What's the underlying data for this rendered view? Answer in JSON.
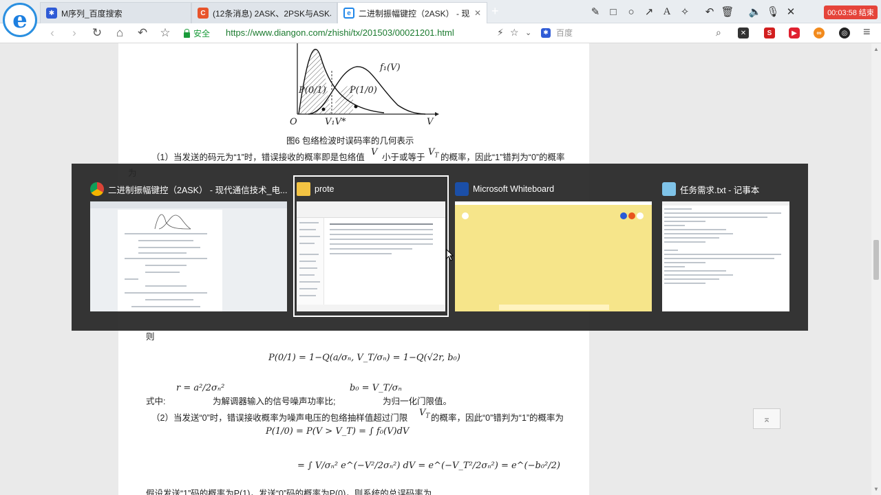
{
  "tabs": [
    {
      "label": "M序列_百度搜索",
      "active": false
    },
    {
      "label": "(12条消息) 2ASK、2PSK与ASK、P",
      "active": false
    },
    {
      "label": "二进制振幅键控（2ASK） - 现代",
      "active": true
    }
  ],
  "new_tab_label": "+",
  "timer": {
    "text": "00:03:58 结束"
  },
  "address": {
    "secure_label": "安全",
    "url": "https://www.diangon.com/zhishi/tx/201503/00021201.html",
    "search_placeholder": "百度"
  },
  "article": {
    "fig_f1": "f₁(V)",
    "fig_p01": "P(0/1)",
    "fig_p10": "P(1/0)",
    "fig_o": "O",
    "fig_vt": "V₁V*",
    "fig_v": "V",
    "figure_caption": "图6 包络检波时误码率的几何表示",
    "para1_a": "（1）当发送的码元为“1”时，错误接收的概率即是包络值",
    "para1_b": "小于或等于",
    "para1_c": "的概率，因此“1”错判为“0”的概率",
    "para1_d": "为",
    "then": "则",
    "formula_p01": "P(0/1) = 1−Q(a/σₙ, V_T/σₙ) = 1−Q(√2r, b₀)",
    "where_label": "式中:",
    "r_def": "r = a²/2σₙ²",
    "r_desc": "为解调器输入的信号噪声功率比;",
    "b0_def": "b₀ = V_T/σₙ",
    "b0_desc": "为归一化门限值。",
    "para2_a": "（2）当发送“0”时，错误接收概率为噪声电压的包络抽样值超过门限",
    "para2_b": "的概率，因此“0”错判为“1”的概率为",
    "formula_p10": "P(1/0) = P(V > V_T) = ∫ f₀(V)dV",
    "formula_int": "= ∫ V/σₙ² e^(−V²/2σₙ²) dV = e^(−V_T²/2σₙ²) = e^(−b₀²/2)",
    "para3": "假设发送“1”码的概率为P(1)，发送“0”码的概率为P(0)，则系统的总误码率为"
  },
  "switcher": {
    "windows": [
      {
        "title": "二进制振幅键控（2ASK） - 现代通信技术_电...",
        "app": "chrome"
      },
      {
        "title": "prote",
        "app": "explorer",
        "selected": true
      },
      {
        "title": "Microsoft Whiteboard",
        "app": "whiteboard"
      },
      {
        "title": "任务需求.txt - 记事本",
        "app": "notepad"
      }
    ]
  },
  "colors": {
    "timer_bg": "#e5443a",
    "url_green": "#1a7a2e",
    "whiteboard_bg": "#f6e58a",
    "switcher_bg": "#262626"
  }
}
